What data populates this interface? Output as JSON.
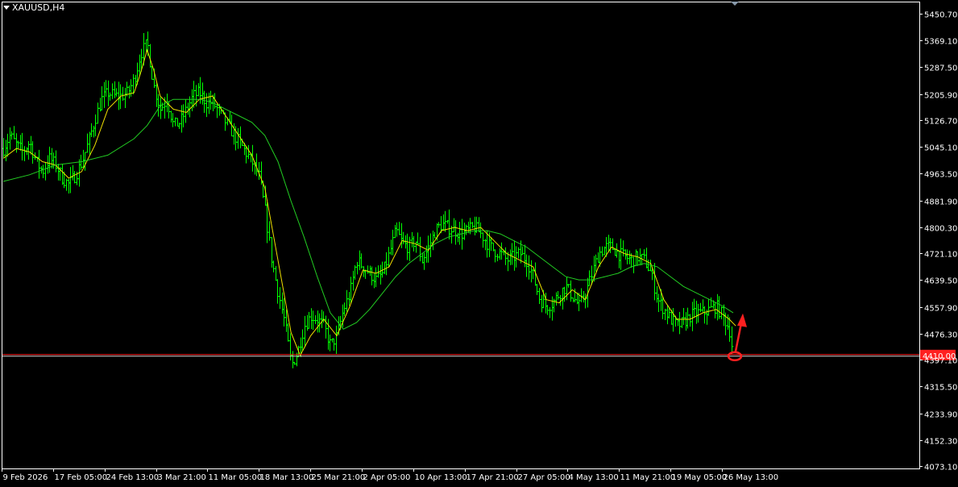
{
  "window": {
    "symbol_label": "XAUUSD,H4"
  },
  "colors": {
    "background": "#000000",
    "bar": "#00ff00",
    "ma_fast": "#f0e000",
    "ma_slow": "#22cc22",
    "axis": "#ffffff",
    "price_line": "#ff2020",
    "marker": "#ff2020"
  },
  "chart_data": {
    "type": "ohlc",
    "title": "",
    "symbol": "XAUUSD",
    "timeframe": "H4",
    "ylim": [
      4073.1,
      5450.7
    ],
    "y_ticks": [
      "5450.70",
      "5369.10",
      "5287.50",
      "5205.90",
      "5126.70",
      "5045.10",
      "4963.50",
      "4881.90",
      "4800.30",
      "4721.10",
      "4639.50",
      "4557.90",
      "4476.30",
      "4397.10",
      "4315.50",
      "4233.90",
      "4152.30",
      "4073.10"
    ],
    "x_ticks": [
      "9 Feb 2026",
      "17 Feb 05:00",
      "24 Feb 13:00",
      "3 Mar 21:00",
      "11 Mar 05:00",
      "18 Mar 13:00",
      "25 Mar 21:00",
      "2 Apr 05:00",
      "10 Apr 13:00",
      "17 Apr 21:00",
      "27 Apr 05:00",
      "4 May 13:00",
      "11 May 21:00",
      "19 May 05:00",
      "26 May 13:00"
    ],
    "current_price": "4410.00",
    "grid": false,
    "close_path": [
      [
        0,
        5040
      ],
      [
        5,
        5080
      ],
      [
        10,
        5050
      ],
      [
        15,
        5030
      ],
      [
        20,
        5060
      ],
      [
        25,
        5000
      ],
      [
        30,
        4970
      ],
      [
        35,
        5010
      ],
      [
        40,
        4990
      ],
      [
        45,
        4950
      ],
      [
        50,
        4930
      ],
      [
        55,
        4960
      ],
      [
        60,
        5000
      ],
      [
        65,
        5060
      ],
      [
        70,
        5130
      ],
      [
        75,
        5190
      ],
      [
        80,
        5210
      ],
      [
        85,
        5200
      ],
      [
        90,
        5200
      ],
      [
        95,
        5210
      ],
      [
        100,
        5250
      ],
      [
        105,
        5330
      ],
      [
        110,
        5360
      ],
      [
        115,
        5230
      ],
      [
        120,
        5160
      ],
      [
        125,
        5190
      ],
      [
        130,
        5110
      ],
      [
        135,
        5120
      ],
      [
        140,
        5160
      ],
      [
        145,
        5200
      ],
      [
        150,
        5210
      ],
      [
        155,
        5180
      ],
      [
        160,
        5180
      ],
      [
        165,
        5150
      ],
      [
        170,
        5120
      ],
      [
        175,
        5090
      ],
      [
        180,
        5060
      ],
      [
        185,
        5030
      ],
      [
        190,
        5000
      ],
      [
        195,
        4960
      ],
      [
        200,
        4850
      ],
      [
        205,
        4700
      ],
      [
        210,
        4600
      ],
      [
        215,
        4510
      ],
      [
        220,
        4380
      ],
      [
        225,
        4420
      ],
      [
        230,
        4500
      ],
      [
        235,
        4530
      ],
      [
        240,
        4520
      ],
      [
        245,
        4500
      ],
      [
        250,
        4440
      ],
      [
        255,
        4470
      ],
      [
        260,
        4550
      ],
      [
        265,
        4600
      ],
      [
        270,
        4700
      ],
      [
        275,
        4680
      ],
      [
        280,
        4660
      ],
      [
        285,
        4640
      ],
      [
        290,
        4660
      ],
      [
        295,
        4720
      ],
      [
        300,
        4790
      ],
      [
        305,
        4750
      ],
      [
        310,
        4740
      ],
      [
        315,
        4760
      ],
      [
        320,
        4700
      ],
      [
        325,
        4740
      ],
      [
        330,
        4790
      ],
      [
        335,
        4810
      ],
      [
        340,
        4800
      ],
      [
        345,
        4790
      ],
      [
        350,
        4780
      ],
      [
        355,
        4790
      ],
      [
        360,
        4800
      ],
      [
        365,
        4780
      ],
      [
        370,
        4750
      ],
      [
        375,
        4730
      ],
      [
        380,
        4720
      ],
      [
        385,
        4700
      ],
      [
        390,
        4710
      ],
      [
        395,
        4720
      ],
      [
        400,
        4700
      ],
      [
        405,
        4650
      ],
      [
        410,
        4580
      ],
      [
        415,
        4560
      ],
      [
        420,
        4570
      ],
      [
        425,
        4600
      ],
      [
        430,
        4620
      ],
      [
        435,
        4590
      ],
      [
        440,
        4560
      ],
      [
        445,
        4600
      ],
      [
        450,
        4660
      ],
      [
        455,
        4720
      ],
      [
        460,
        4740
      ],
      [
        465,
        4740
      ],
      [
        470,
        4720
      ],
      [
        475,
        4710
      ],
      [
        480,
        4700
      ],
      [
        485,
        4710
      ],
      [
        490,
        4700
      ],
      [
        495,
        4660
      ],
      [
        500,
        4580
      ],
      [
        505,
        4550
      ],
      [
        510,
        4520
      ],
      [
        515,
        4500
      ],
      [
        520,
        4510
      ],
      [
        525,
        4530
      ],
      [
        530,
        4540
      ],
      [
        535,
        4540
      ],
      [
        540,
        4550
      ],
      [
        545,
        4560
      ],
      [
        550,
        4530
      ],
      [
        555,
        4490
      ],
      [
        558,
        4410
      ]
    ],
    "moving_averages": [
      {
        "name": "",
        "color": "ma_fast",
        "path": [
          [
            0,
            5010
          ],
          [
            10,
            5040
          ],
          [
            20,
            5030
          ],
          [
            30,
            5000
          ],
          [
            40,
            4990
          ],
          [
            50,
            4950
          ],
          [
            60,
            4970
          ],
          [
            70,
            5050
          ],
          [
            80,
            5160
          ],
          [
            90,
            5200
          ],
          [
            100,
            5210
          ],
          [
            105,
            5270
          ],
          [
            110,
            5340
          ],
          [
            115,
            5280
          ],
          [
            120,
            5200
          ],
          [
            130,
            5160
          ],
          [
            140,
            5150
          ],
          [
            150,
            5190
          ],
          [
            160,
            5200
          ],
          [
            170,
            5140
          ],
          [
            180,
            5080
          ],
          [
            190,
            5020
          ],
          [
            200,
            4920
          ],
          [
            210,
            4700
          ],
          [
            220,
            4480
          ],
          [
            227,
            4410
          ],
          [
            235,
            4470
          ],
          [
            245,
            4520
          ],
          [
            255,
            4470
          ],
          [
            265,
            4560
          ],
          [
            275,
            4670
          ],
          [
            285,
            4660
          ],
          [
            295,
            4680
          ],
          [
            305,
            4760
          ],
          [
            315,
            4750
          ],
          [
            325,
            4730
          ],
          [
            335,
            4790
          ],
          [
            345,
            4800
          ],
          [
            355,
            4790
          ],
          [
            365,
            4800
          ],
          [
            375,
            4760
          ],
          [
            385,
            4720
          ],
          [
            395,
            4700
          ],
          [
            405,
            4680
          ],
          [
            415,
            4580
          ],
          [
            425,
            4570
          ],
          [
            435,
            4610
          ],
          [
            445,
            4580
          ],
          [
            455,
            4680
          ],
          [
            465,
            4740
          ],
          [
            475,
            4720
          ],
          [
            485,
            4710
          ],
          [
            495,
            4690
          ],
          [
            505,
            4580
          ],
          [
            515,
            4520
          ],
          [
            525,
            4520
          ],
          [
            535,
            4540
          ],
          [
            545,
            4550
          ],
          [
            555,
            4520
          ],
          [
            560,
            4500
          ]
        ]
      },
      {
        "name": "",
        "color": "ma_slow",
        "path": [
          [
            0,
            4940
          ],
          [
            20,
            4960
          ],
          [
            40,
            4990
          ],
          [
            60,
            5000
          ],
          [
            80,
            5020
          ],
          [
            100,
            5070
          ],
          [
            110,
            5110
          ],
          [
            120,
            5170
          ],
          [
            130,
            5190
          ],
          [
            140,
            5190
          ],
          [
            150,
            5190
          ],
          [
            160,
            5180
          ],
          [
            170,
            5160
          ],
          [
            180,
            5140
          ],
          [
            190,
            5120
          ],
          [
            200,
            5080
          ],
          [
            210,
            5000
          ],
          [
            220,
            4880
          ],
          [
            230,
            4770
          ],
          [
            240,
            4650
          ],
          [
            250,
            4540
          ],
          [
            260,
            4490
          ],
          [
            270,
            4510
          ],
          [
            280,
            4550
          ],
          [
            290,
            4600
          ],
          [
            300,
            4650
          ],
          [
            310,
            4690
          ],
          [
            320,
            4720
          ],
          [
            330,
            4750
          ],
          [
            340,
            4770
          ],
          [
            350,
            4780
          ],
          [
            360,
            4790
          ],
          [
            370,
            4790
          ],
          [
            380,
            4780
          ],
          [
            390,
            4760
          ],
          [
            400,
            4740
          ],
          [
            410,
            4710
          ],
          [
            420,
            4680
          ],
          [
            430,
            4650
          ],
          [
            440,
            4640
          ],
          [
            450,
            4640
          ],
          [
            460,
            4650
          ],
          [
            470,
            4660
          ],
          [
            480,
            4680
          ],
          [
            490,
            4690
          ],
          [
            500,
            4680
          ],
          [
            510,
            4650
          ],
          [
            520,
            4620
          ],
          [
            530,
            4600
          ],
          [
            540,
            4580
          ],
          [
            550,
            4560
          ],
          [
            558,
            4540
          ]
        ]
      }
    ]
  }
}
